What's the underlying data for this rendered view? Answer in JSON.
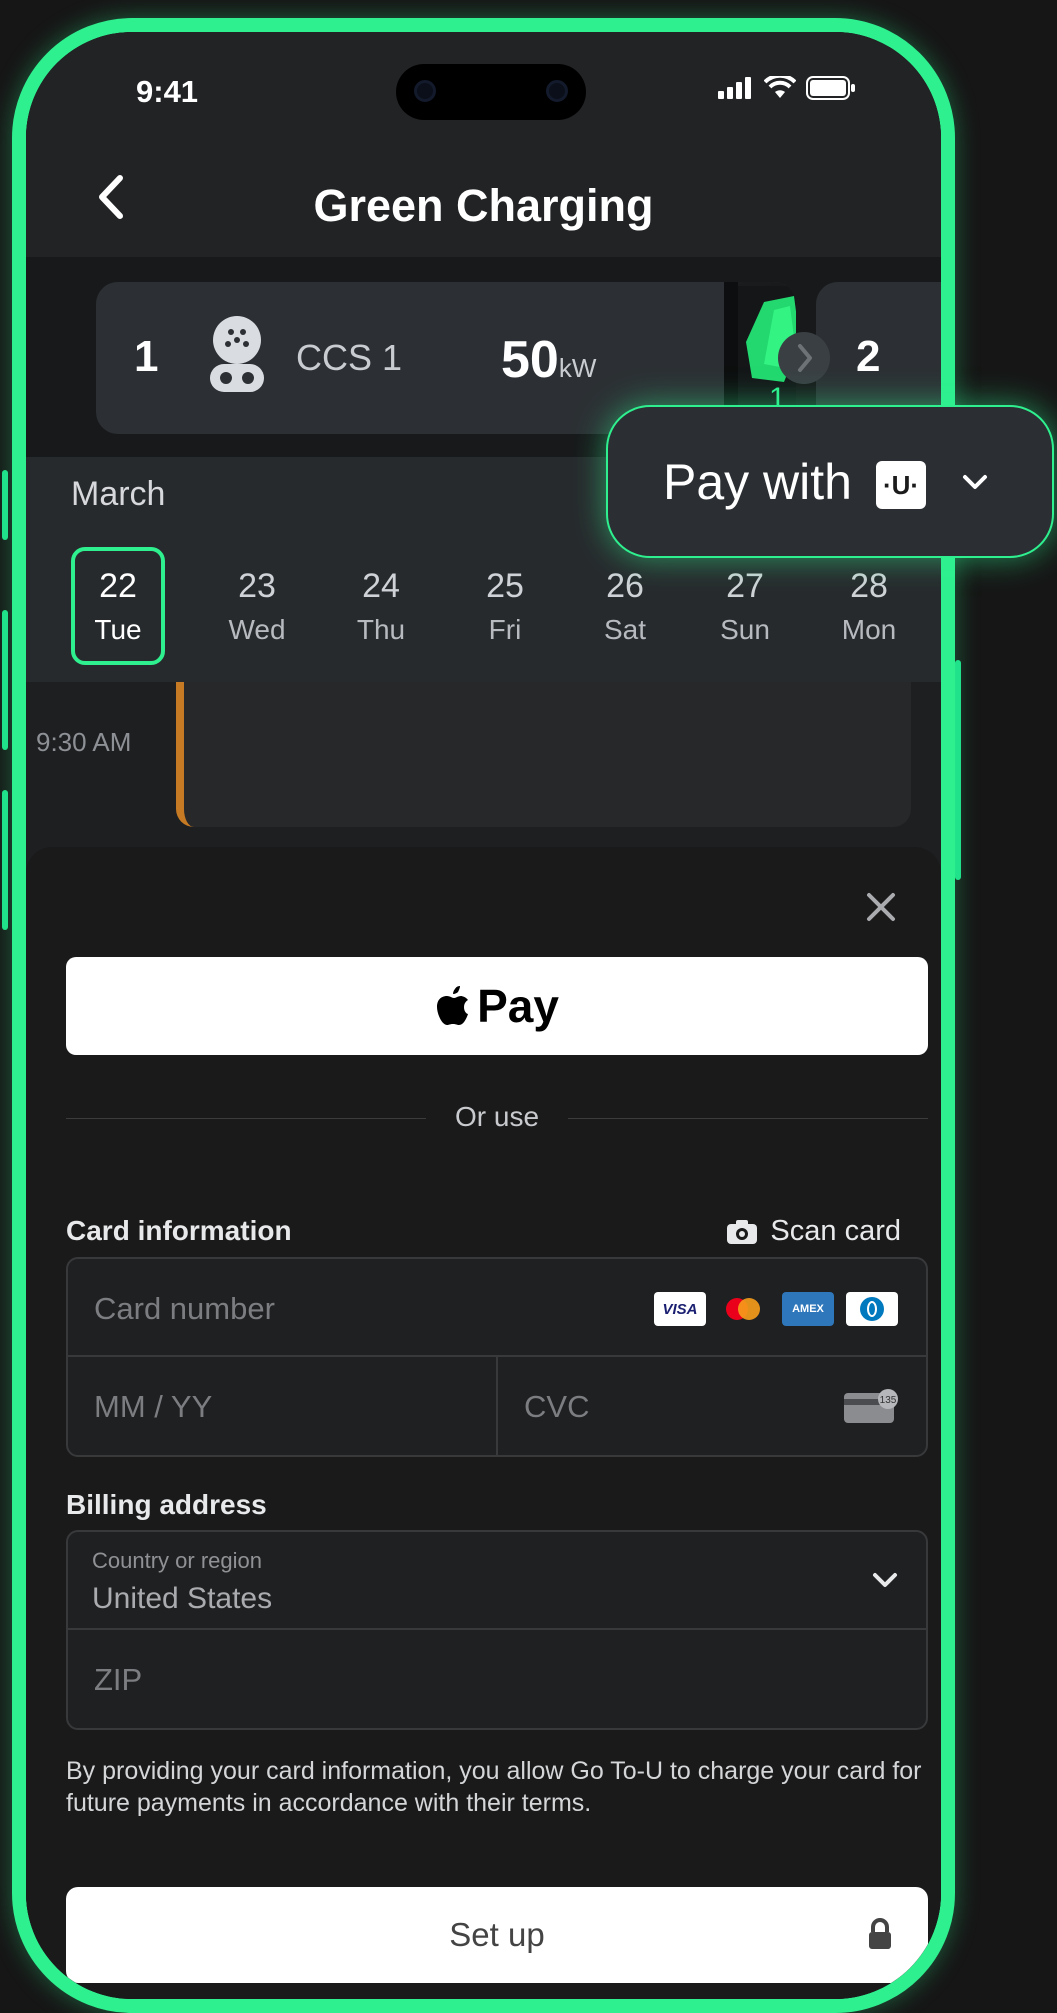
{
  "status_bar": {
    "time": "9:41"
  },
  "header": {
    "title": "Green Charging"
  },
  "connectors": [
    {
      "index": "1",
      "type": "CCS 1",
      "power": "50",
      "unit": "kW"
    },
    {
      "index": "2"
    }
  ],
  "charger_photo_labels": {
    "left": "1",
    "right": "2"
  },
  "calendar": {
    "month": "March",
    "days": [
      {
        "num": "22",
        "dow": "Tue",
        "selected": true
      },
      {
        "num": "23",
        "dow": "Wed"
      },
      {
        "num": "24",
        "dow": "Thu"
      },
      {
        "num": "25",
        "dow": "Fri"
      },
      {
        "num": "26",
        "dow": "Sat"
      },
      {
        "num": "27",
        "dow": "Sun"
      },
      {
        "num": "28",
        "dow": "Mon"
      }
    ]
  },
  "schedule": {
    "slot_time": "9:30 AM"
  },
  "pay_with": {
    "label": "Pay with",
    "provider_logo_text": "·U·"
  },
  "payment_sheet": {
    "apple_pay_label": "Pay",
    "divider_text": "Or use",
    "card_section_label": "Card information",
    "scan_card_label": "Scan card",
    "card_number_placeholder": "Card number",
    "card_brands": [
      "VISA",
      "mastercard",
      "AMEX",
      "Diners"
    ],
    "expiry_placeholder": "MM / YY",
    "cvc_placeholder": "CVC",
    "cvc_icon_text": "135",
    "billing_section_label": "Billing address",
    "country_label": "Country or region",
    "country_value": "United States",
    "zip_placeholder": "ZIP",
    "consent_text": "By providing your card information, you allow Go To-U to charge your card for future payments in accordance with their terms.",
    "setup_button_label": "Set up"
  },
  "colors": {
    "accent": "#2ff08f",
    "slot_border": "#c77a24",
    "background": "#1e1f21"
  }
}
